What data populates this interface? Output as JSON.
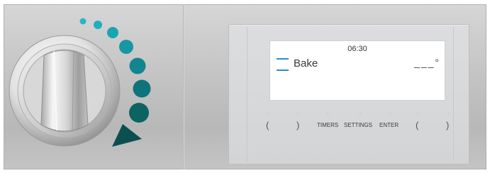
{
  "display": {
    "time": "06:30",
    "mode": "Bake",
    "temperature": "___°"
  },
  "buttons": {
    "left_open": "(",
    "left_close": ")",
    "timers": "TIMERS",
    "settings": "SETTINGS",
    "enter": "ENTER",
    "right_open": "(",
    "right_close": ")"
  },
  "colors": {
    "accent": "#2a8fc9",
    "dial_teal_light": "#1fb1c0",
    "dial_teal_dark": "#0a5e5c",
    "panel": "#d6d7d9",
    "brushed_metal": "#c3c3c3"
  },
  "icons": {
    "knob": "rotary-knob",
    "level_dots": "temperature-level-dots-icon",
    "pointer": "triangle-pointer-icon"
  }
}
